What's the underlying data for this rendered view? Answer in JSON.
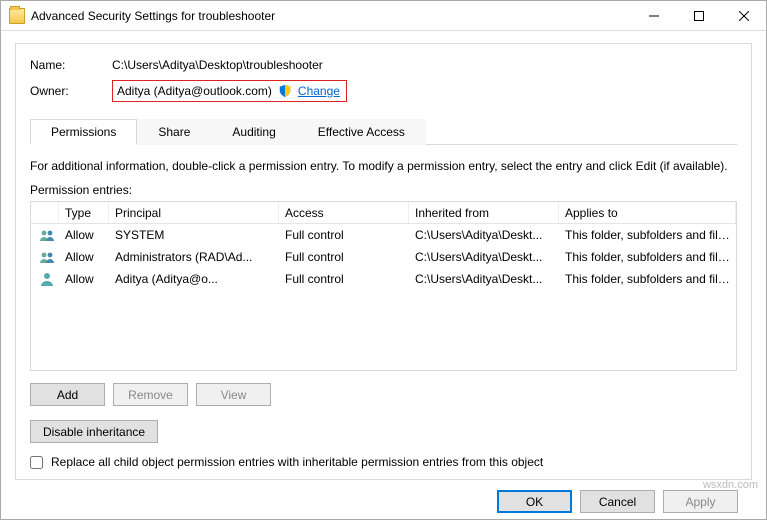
{
  "window": {
    "title": "Advanced Security Settings for troubleshooter"
  },
  "fields": {
    "name_label": "Name:",
    "name_value": "C:\\Users\\Aditya\\Desktop\\troubleshooter",
    "owner_label": "Owner:",
    "owner_value": "Aditya (Aditya@outlook.com)",
    "change_link": "Change"
  },
  "tabs": {
    "permissions": "Permissions",
    "share": "Share",
    "auditing": "Auditing",
    "effective": "Effective Access"
  },
  "info_text": "For additional information, double-click a permission entry. To modify a permission entry, select the entry and click Edit (if available).",
  "entries_label": "Permission entries:",
  "columns": {
    "type": "Type",
    "principal": "Principal",
    "access": "Access",
    "inherited": "Inherited from",
    "applies": "Applies to"
  },
  "rows": [
    {
      "icon": "group",
      "type": "Allow",
      "principal": "SYSTEM",
      "access": "Full control",
      "inherited": "C:\\Users\\Aditya\\Deskt...",
      "applies": "This folder, subfolders and files"
    },
    {
      "icon": "group",
      "type": "Allow",
      "principal": "Administrators (RAD\\Ad...",
      "access": "Full control",
      "inherited": "C:\\Users\\Aditya\\Deskt...",
      "applies": "This folder, subfolders and files"
    },
    {
      "icon": "person",
      "type": "Allow",
      "principal": "Aditya (Aditya@o...",
      "access": "Full control",
      "inherited": "C:\\Users\\Aditya\\Deskt...",
      "applies": "This folder, subfolders and files"
    }
  ],
  "buttons": {
    "add": "Add",
    "remove": "Remove",
    "view": "View",
    "disable_inh": "Disable inheritance",
    "ok": "OK",
    "cancel": "Cancel",
    "apply": "Apply"
  },
  "checkbox_label": "Replace all child object permission entries with inheritable permission entries from this object",
  "watermark": "wsxdn.com"
}
